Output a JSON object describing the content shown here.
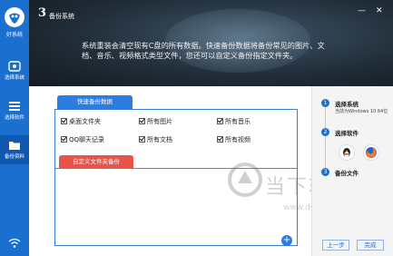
{
  "app": {
    "logo_label": "好系统",
    "title_number": "3",
    "title_text": "备份系统",
    "window_controls": [
      "—",
      "✕"
    ]
  },
  "sidebar": {
    "items": [
      {
        "label": "选择系统",
        "icon": "system-select-icon"
      },
      {
        "label": "选择软件",
        "icon": "menu-list-icon"
      },
      {
        "label": "备份资料",
        "icon": "folder-icon",
        "active": true
      }
    ],
    "bottom_icon": "wifi-icon"
  },
  "banner": {
    "description": "系统重装会清空现有C盘的所有数据。快速备份数据将备份常见的图片、文档、音乐、视频格式类型文件，您还可以自定义备份指定文件夹。"
  },
  "main": {
    "quick_tab_label": "快速备份数据",
    "checkboxes": [
      {
        "label": "桌面文件夹",
        "checked": true
      },
      {
        "label": "所有图片",
        "checked": true
      },
      {
        "label": "所有音乐",
        "checked": true
      },
      {
        "label": "QQ聊天记录",
        "checked": true
      },
      {
        "label": "所有文档",
        "checked": true
      },
      {
        "label": "所有视频",
        "checked": true
      }
    ],
    "custom_tab_label": "自定义文件夹备份",
    "add_button": "+"
  },
  "steps": [
    {
      "num": "1",
      "title": "选择系统",
      "sub": "当前为Windows 10 64位"
    },
    {
      "num": "2",
      "title": "选择软件"
    },
    {
      "num": "3",
      "title": "备份文件"
    }
  ],
  "step_apps": [
    "qq-penguin-icon",
    "firefox-icon"
  ],
  "buttons": {
    "prev": "上一步",
    "finish": "完成"
  },
  "watermark": {
    "text": "当下软件园",
    "url": "www.downxia.com"
  },
  "colors": {
    "sidebar": "#1a6fcf",
    "accent_blue": "#2d7de0",
    "accent_red": "#e8534a",
    "banner_dark": "#1f2b36"
  }
}
